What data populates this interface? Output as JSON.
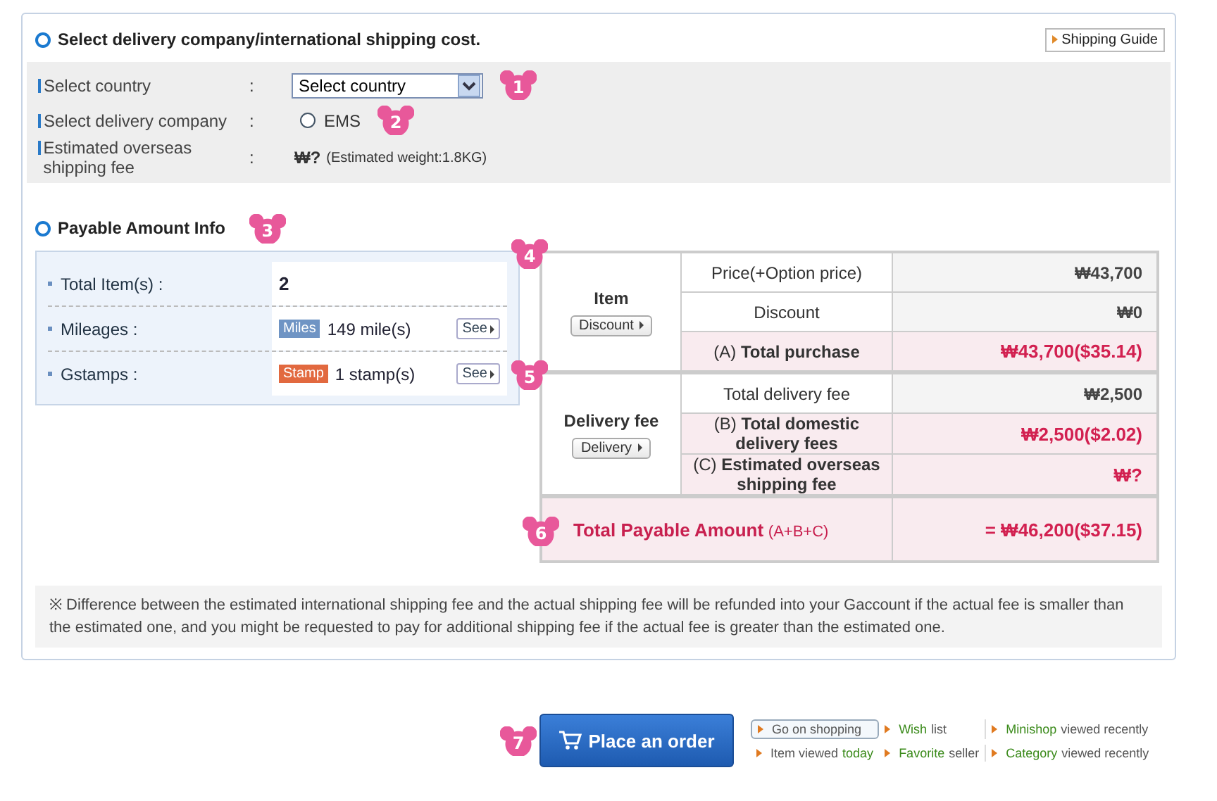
{
  "shipping": {
    "title": "Select delivery company/international shipping cost.",
    "guide_button": "Shipping Guide",
    "rows": [
      {
        "kind": "select",
        "label": "Select country",
        "colon": ":",
        "value": "Select country",
        "badge": "1"
      },
      {
        "kind": "radio",
        "label": "Select delivery company",
        "colon": ":",
        "option": "EMS",
        "selected": false,
        "badge": "2"
      },
      {
        "kind": "fee",
        "label": "Estimated overseas shipping fee",
        "colon": ":",
        "value": "₩?",
        "note": "(Estimated weight:1.8KG)"
      }
    ]
  },
  "payable": {
    "title": "Payable Amount Info",
    "badge": "3",
    "info": [
      {
        "kind": "count",
        "label": "Total Item(s) :",
        "value": "2"
      },
      {
        "kind": "tag",
        "label": "Mileages :",
        "tag": "Miles",
        "color": "#6f94c4",
        "value": "149 mile(s)",
        "button": "See"
      },
      {
        "kind": "tag",
        "label": "Gstamps :",
        "tag": "Stamp",
        "color": "#e2693f",
        "value": "1 stamp(s)",
        "button": "See"
      }
    ]
  },
  "summary": {
    "groups": [
      {
        "label": "Item",
        "button": "Discount",
        "badge": "4",
        "rows": [
          {
            "label": "Price(+Option price)",
            "value": "₩43,700",
            "highlight": false
          },
          {
            "label": "Discount",
            "value": "₩0",
            "highlight": false
          },
          {
            "label": "(A) **Total purchase**",
            "value": "₩43,700($35.14)",
            "highlight": true
          }
        ]
      },
      {
        "label": "Delivery fee",
        "button": "Delivery",
        "badge": "5",
        "rows": [
          {
            "label": "Total delivery fee",
            "value": "₩2,500",
            "highlight": false
          },
          {
            "label": "(B) **Total domestic delivery fees**",
            "value": "₩2,500($2.02)",
            "highlight": true
          },
          {
            "label": "(C) **Estimated overseas shipping fee**",
            "value": "₩?",
            "highlight": true
          }
        ]
      }
    ],
    "total": {
      "label": "Total Payable Amount",
      "suffix": "(A+B+C)",
      "value": "= ₩46,200($37.15)",
      "badge": "6"
    }
  },
  "note": "※ Difference between the estimated international shipping fee and the actual shipping fee will be refunded into your Gaccount if the actual fee is smaller than the estimated one, and you might be requested to pay for additional shipping fee if the actual fee is greater than the estimated one.",
  "footer": {
    "badge": "7",
    "order_button": "Place an order",
    "links": [
      {
        "boxed": true,
        "parts": [
          {
            "text": "Go on shopping",
            "accent": false
          }
        ]
      },
      {
        "boxed": false,
        "parts": [
          {
            "text": "Wish",
            "accent": true
          },
          {
            "text": "list",
            "accent": false
          }
        ]
      },
      {
        "boxed": false,
        "parts": [
          {
            "text": "Minishop",
            "accent": true
          },
          {
            "text": "viewed recently",
            "accent": false
          }
        ]
      },
      {
        "boxed": false,
        "parts": [
          {
            "text": "Item viewed",
            "accent": false
          },
          {
            "text": "today",
            "accent": true
          }
        ]
      },
      {
        "boxed": false,
        "parts": [
          {
            "text": "Favorite",
            "accent": true
          },
          {
            "text": "seller",
            "accent": false
          }
        ]
      },
      {
        "boxed": false,
        "parts": [
          {
            "text": "Category",
            "accent": true
          },
          {
            "text": "viewed recently",
            "accent": false
          }
        ]
      }
    ]
  }
}
